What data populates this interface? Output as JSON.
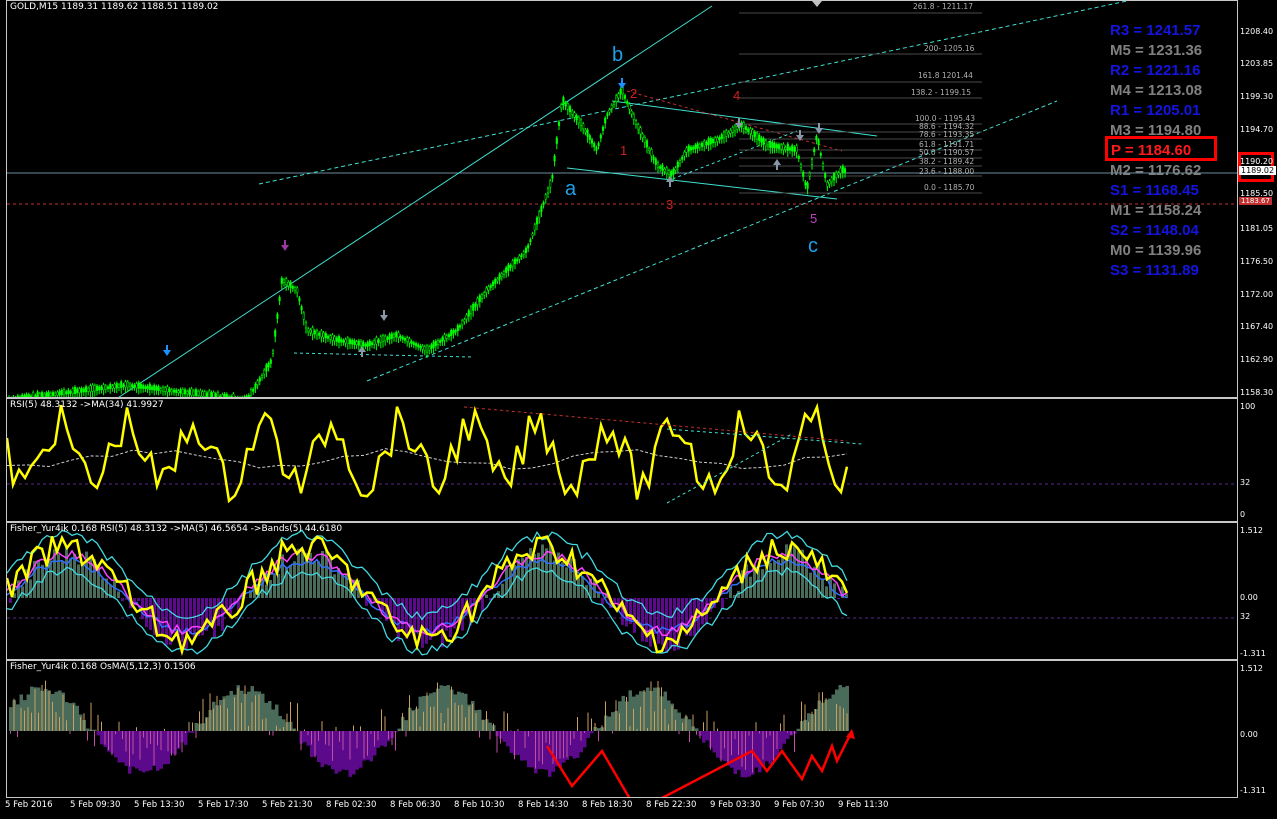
{
  "main_title": "GOLD,M15  1189.31 1189.62 1188.51 1189.02",
  "rsi_title": "RSI(5) 48.3132  ->MA(34) 41.9927",
  "fisher_title": "Fisher_Yur4ik 0.168  RSI(5) 48.3132  ->MA(5) 46.5654  ->Bands(5) 44.6180",
  "osma_title": "Fisher_Yur4ik 0.168  OsMA(5,12,3) 0.1506",
  "price_ticks": [
    "1208.40",
    "1203.85",
    "1199.30",
    "1194.70",
    "1190.20",
    "1185.50",
    "1181.05",
    "1176.50",
    "1172.00",
    "1167.40",
    "1162.90",
    "1158.30"
  ],
  "current_price": "1189.02",
  "red_level_price": "1183.67",
  "rsi_ticks": [
    "100",
    "32",
    "0"
  ],
  "fisher_ticks": [
    "1.512",
    "0.00",
    "32",
    "-1.311"
  ],
  "osma_ticks": [
    "1.512",
    "0.00",
    "-1.311"
  ],
  "pivots": [
    {
      "label": "R3 = 1241.57",
      "color": "#1414e0"
    },
    {
      "label": "M5 = 1231.36",
      "color": "#808080"
    },
    {
      "label": "R2 = 1221.16",
      "color": "#1414e0"
    },
    {
      "label": "M4 = 1213.08",
      "color": "#808080"
    },
    {
      "label": "R1 = 1205.01",
      "color": "#1414e0"
    },
    {
      "label": "M3 = 1194.80",
      "color": "#808080"
    },
    {
      "label": "P  = 1184.60",
      "color": "#ff1a1a"
    },
    {
      "label": "M2 = 1176.62",
      "color": "#808080"
    },
    {
      "label": "S1 = 1168.45",
      "color": "#1414e0"
    },
    {
      "label": "M1 = 1158.24",
      "color": "#808080"
    },
    {
      "label": "S2 = 1148.04",
      "color": "#1414e0"
    },
    {
      "label": "M0 = 1139.96",
      "color": "#808080"
    },
    {
      "label": "S3 = 1131.89",
      "color": "#1414e0"
    }
  ],
  "fib_levels": [
    "261.8 - 1211.17",
    "200- 1205.16",
    "161.8 1201.44",
    "138.2 - 1199.15",
    "100.0 - 1195.43",
    "88.6 - 1194.32",
    "78.6 - 1193.35",
    "61.8 - 1191.71",
    "50.0 - 1190.57",
    "38.2 - 1189.42",
    "23.6 - 1188.00",
    "0.0 - 1185.70"
  ],
  "wave_labels": {
    "a": "a",
    "b": "b",
    "c": "c",
    "n1": "1",
    "n2": "2",
    "n3": "3",
    "n4": "4",
    "n5": "5"
  },
  "time_labels": [
    "5 Feb 2016",
    "5 Feb 09:30",
    "5 Feb 13:30",
    "5 Feb 17:30",
    "5 Feb 21:30",
    "8 Feb 02:30",
    "8 Feb 06:30",
    "8 Feb 10:30",
    "8 Feb 14:30",
    "8 Feb 18:30",
    "8 Feb 22:30",
    "9 Feb 03:30",
    "9 Feb 07:30",
    "9 Feb 11:30"
  ],
  "colors": {
    "candles": "#00ff00",
    "trend": "#40e0d0",
    "rsi": "#ffff00",
    "pivot_box": "#ff0000",
    "histogram_pos": "#4a6a5a",
    "histogram_neg": "#5a0a8a",
    "arrow": "#ff0000"
  }
}
